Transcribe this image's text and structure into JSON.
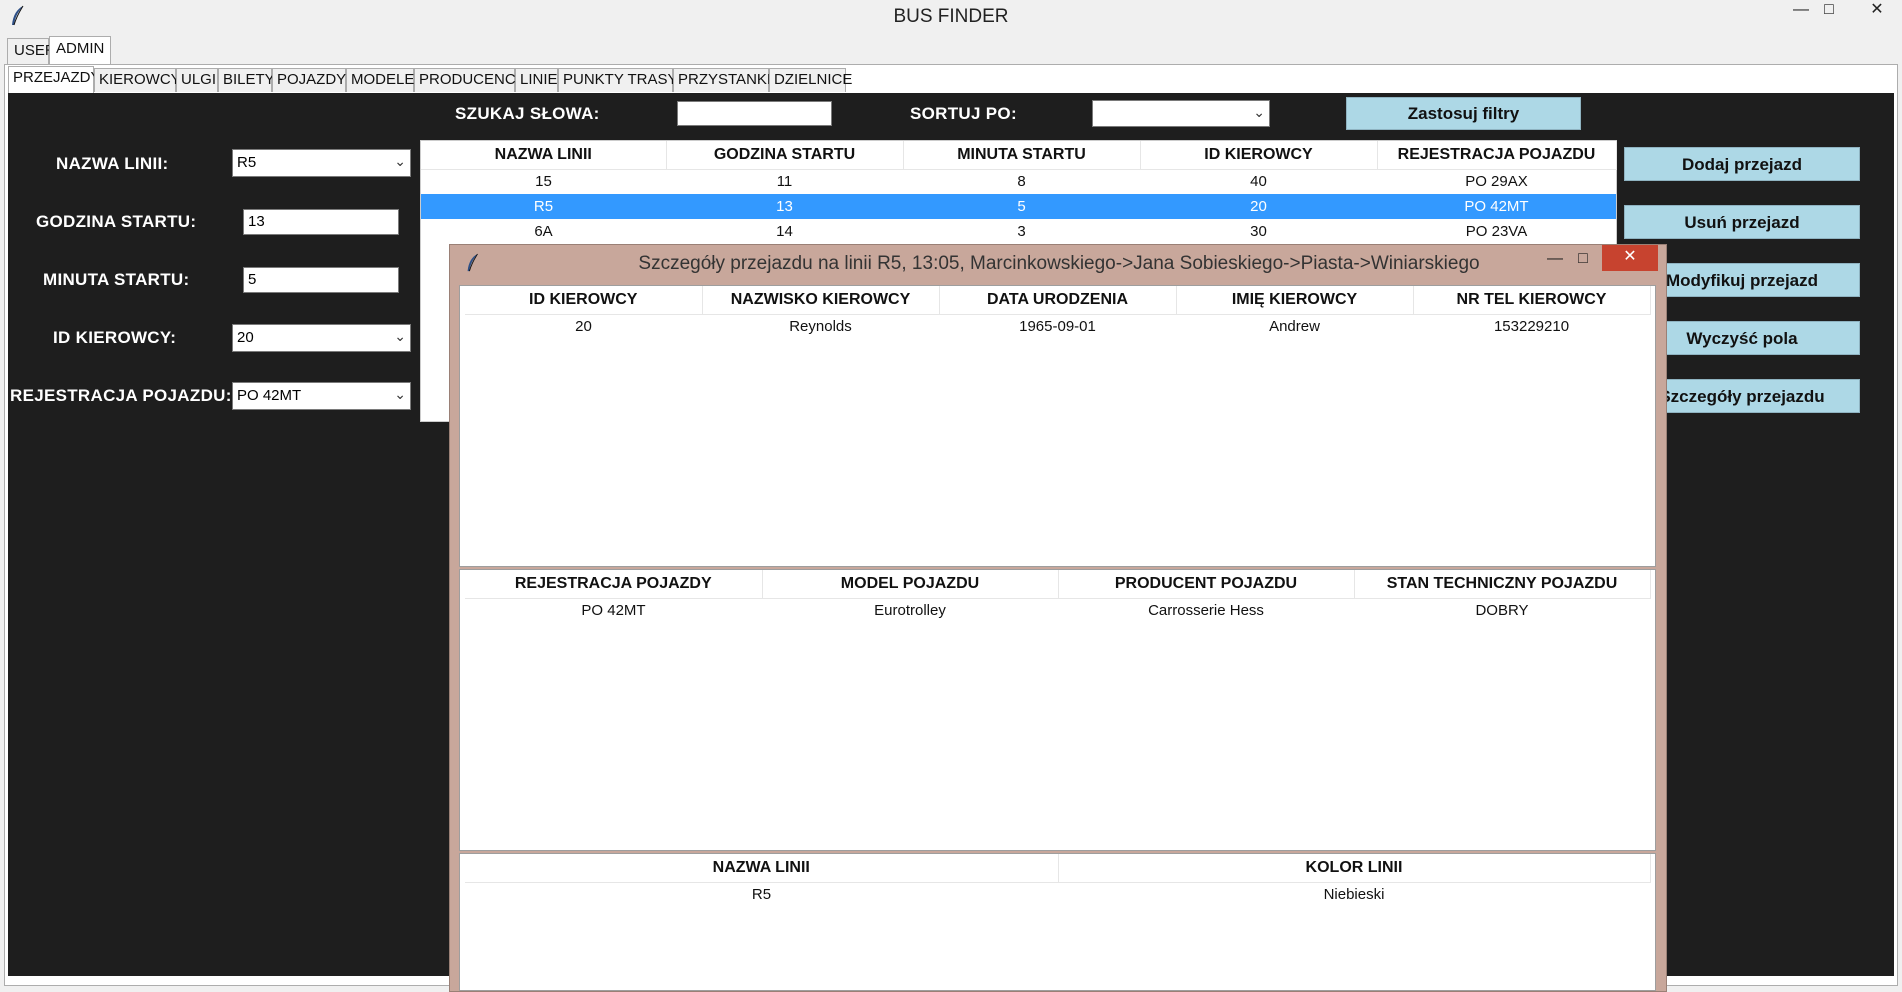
{
  "window": {
    "title": "BUS FINDER",
    "controls": [
      "—",
      "□",
      "✕"
    ]
  },
  "top_tabs": [
    {
      "label": "USER",
      "selected": false
    },
    {
      "label": "ADMIN",
      "selected": true
    }
  ],
  "sub_tabs": [
    {
      "label": "PRZEJAZDY",
      "selected": true
    },
    {
      "label": "KIEROWCY"
    },
    {
      "label": "ULGI"
    },
    {
      "label": "BILETY"
    },
    {
      "label": "POJAZDY"
    },
    {
      "label": "MODELE"
    },
    {
      "label": "PRODUCENCI"
    },
    {
      "label": "LINIE"
    },
    {
      "label": "PUNKTY TRASY"
    },
    {
      "label": "PRZYSTANKI"
    },
    {
      "label": "DZIELNICE"
    }
  ],
  "filters": {
    "search_label": "SZUKAJ SŁOWA:",
    "search_value": "",
    "sort_label": "SORTUJ PO:",
    "sort_value": "",
    "apply_button": "Zastosuj filtry"
  },
  "form": {
    "line_name_label": "NAZWA LINII:",
    "line_name_value": "R5",
    "start_hour_label": "GODZINA STARTU:",
    "start_hour_value": "13",
    "start_minute_label": "MINUTA STARTU:",
    "start_minute_value": "5",
    "driver_id_label": "ID KIEROWCY:",
    "driver_id_value": "20",
    "vehicle_reg_label": "REJESTRACJA POJAZDU:",
    "vehicle_reg_value": "PO 42MT"
  },
  "actions": {
    "add": "Dodaj przejazd",
    "delete": "Usuń przejazd",
    "modify": "Modyfikuj przejazd",
    "clear": "Wyczyść pola",
    "details": "Szczegóły przejazdu"
  },
  "rides_table": {
    "columns": [
      "NAZWA LINII",
      "GODZINA STARTU",
      "MINUTA STARTU",
      "ID KIEROWCY",
      "REJESTRACJA POJAZDU"
    ],
    "rows": [
      [
        "15",
        "11",
        "8",
        "40",
        "PO 29AX"
      ],
      [
        "R5",
        "13",
        "5",
        "20",
        "PO 42MT"
      ],
      [
        "6A",
        "14",
        "3",
        "30",
        "PO 23VA"
      ]
    ],
    "selected_row": 1
  },
  "dialog": {
    "title": "Szczegóły przejazdu na linii R5, 13:05, Marcinkowskiego->Jana Sobieskiego->Piasta->Winiarskiego",
    "driver_table": {
      "columns": [
        "ID KIEROWCY",
        "NAZWISKO KIEROWCY",
        "DATA URODZENIA",
        "IMIĘ KIEROWCY",
        "NR TEL KIEROWCY"
      ],
      "rows": [
        [
          "20",
          "Reynolds",
          "1965-09-01",
          "Andrew",
          "153229210"
        ]
      ]
    },
    "vehicle_table": {
      "columns": [
        "REJESTRACJA POJAZDY",
        "MODEL POJAZDU",
        "PRODUCENT POJAZDU",
        "STAN TECHNICZNY POJAZDU"
      ],
      "rows": [
        [
          "PO 42MT",
          "Eurotrolley",
          "Carrosserie Hess",
          "DOBRY"
        ]
      ]
    },
    "line_table": {
      "columns": [
        "NAZWA LINII",
        "KOLOR LINII"
      ],
      "rows": [
        [
          "R5",
          "Niebieski"
        ]
      ]
    }
  },
  "colors": {
    "dark_panel": "#1e1e1e",
    "button_bg": "#add8e6",
    "selection": "#3399ff",
    "dialog_frame": "#c8a79b",
    "close_button": "#c7432f"
  }
}
